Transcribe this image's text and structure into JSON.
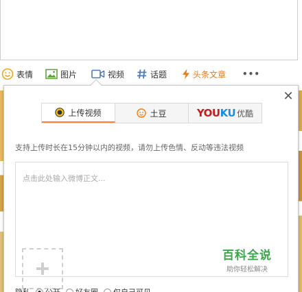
{
  "toolbar": {
    "emoji_label": "表情",
    "image_label": "图片",
    "video_label": "视频",
    "topic_label": "话题",
    "article_label": "头条文章",
    "more_label": "•••"
  },
  "popup": {
    "close_label": "✕",
    "tabs": [
      {
        "label": "上传视频",
        "icon": "upload-video-icon"
      },
      {
        "label": "土豆",
        "icon": "tudou-icon"
      },
      {
        "label": "优酷",
        "brand_you": "YOU",
        "brand_ku": "KU"
      }
    ],
    "notice": "支持上传时长在15分钟以内的视频，请勿上传色情、反动等违法视频",
    "placeholder": "点击此处输入微博正文...",
    "privacy": {
      "label": "隐私",
      "options": [
        "公开",
        "好友圈",
        "仅自己可见"
      ],
      "selected": "公开"
    }
  },
  "watermark": {
    "title": "百科全说",
    "subtitle": "助你轻松解决"
  },
  "colors": {
    "accent_orange": "#ff8140",
    "article_orange": "#e77c19",
    "youku_red": "#c61e1e",
    "youku_blue": "#1a8fe0",
    "watermark_green": "#38a84a"
  }
}
